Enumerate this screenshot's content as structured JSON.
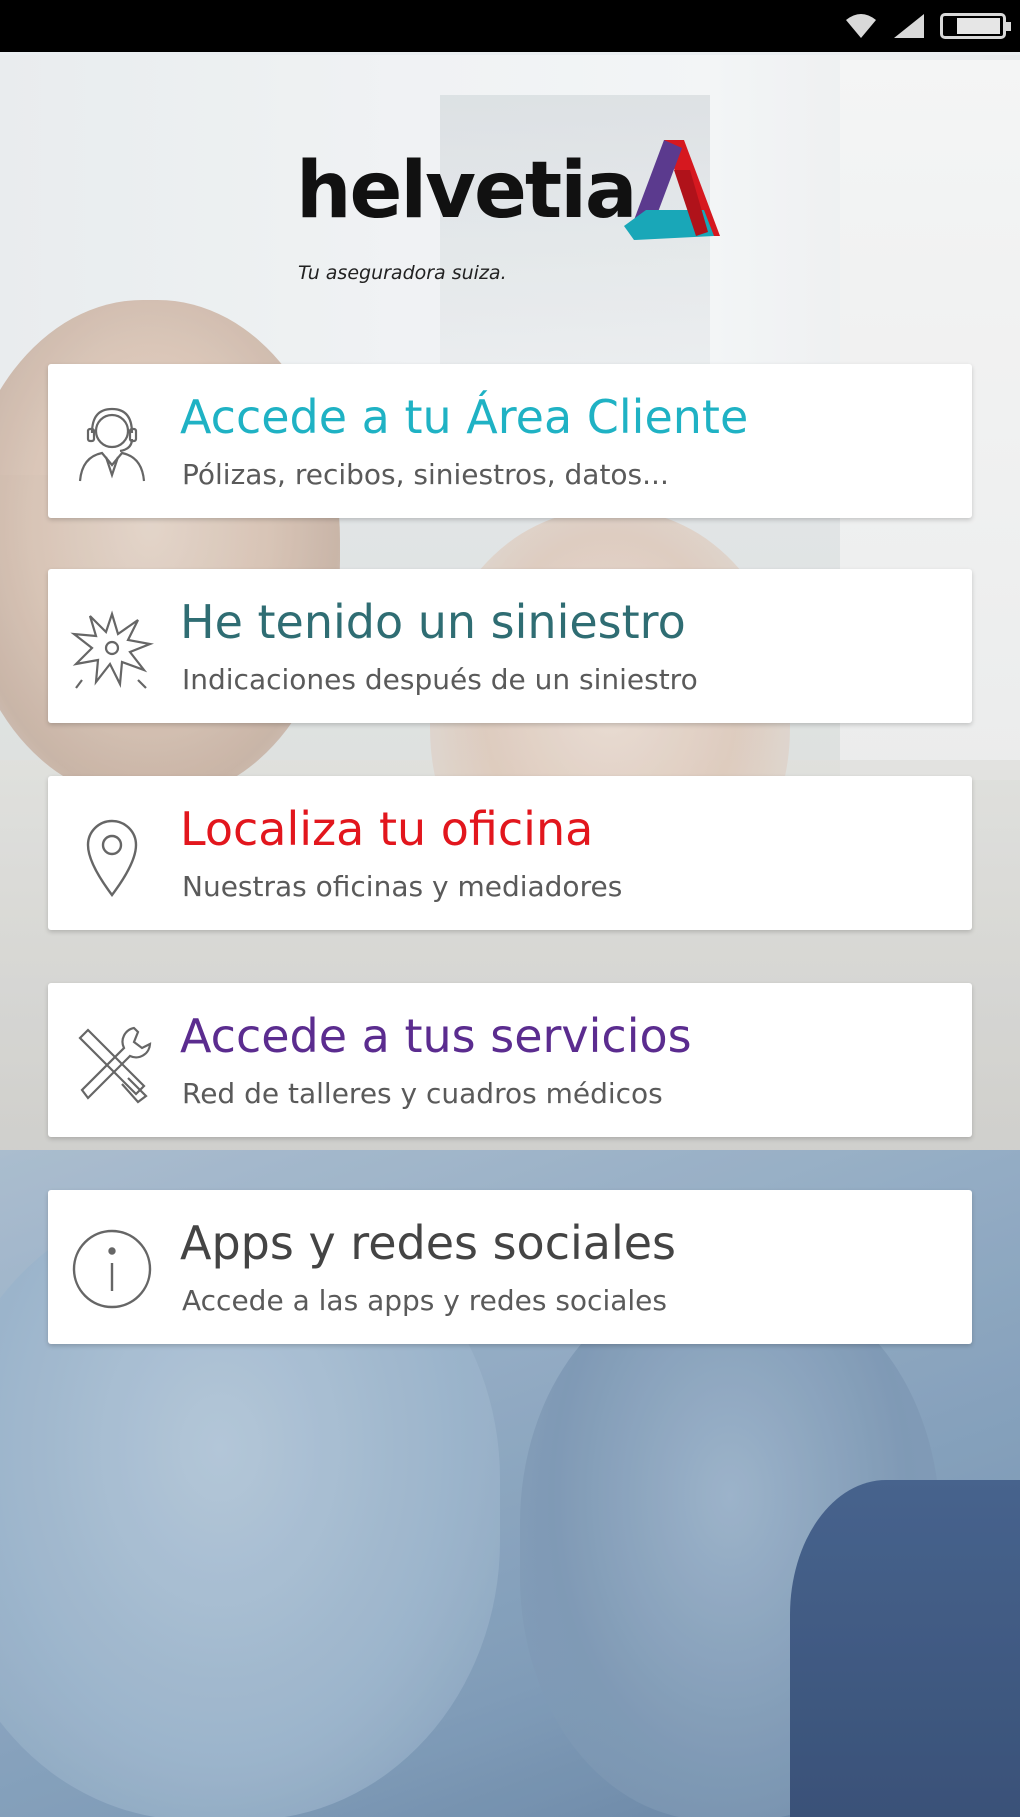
{
  "app": {
    "brand": "helvetia",
    "tagline": "Tu aseguradora suiza."
  },
  "menu": [
    {
      "title": "Accede a tu Área Cliente",
      "subtitle": "Pólizas, recibos, siniestros, datos...",
      "icon": "customer-support-icon",
      "color": "#1fb2c4"
    },
    {
      "title": "He tenido un siniestro",
      "subtitle": "Indicaciones después de un siniestro",
      "icon": "crash-burst-icon",
      "color": "#2f6d73"
    },
    {
      "title": "Localiza tu oficina",
      "subtitle": "Nuestras oficinas y mediadores",
      "icon": "location-pin-icon",
      "color": "#e2161d"
    },
    {
      "title": "Accede a tus servicios",
      "subtitle": "Red de talleres y cuadros médicos",
      "icon": "tools-icon",
      "color": "#5b2c8f"
    },
    {
      "title": "Apps y redes sociales",
      "subtitle": "Accede a las apps y redes sociales",
      "icon": "info-icon",
      "color": "#444444"
    }
  ]
}
